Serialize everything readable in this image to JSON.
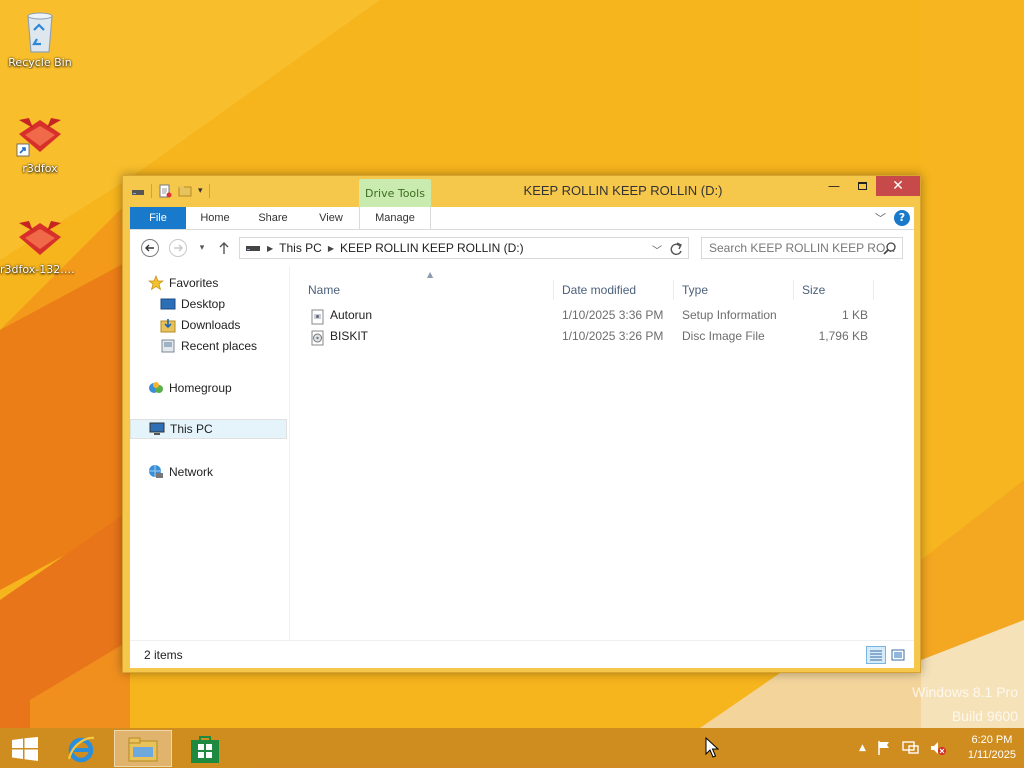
{
  "desktop": {
    "icons": [
      {
        "label": "Recycle Bin",
        "icon": "recycle-bin-icon"
      },
      {
        "label": "r3dfox",
        "icon": "r3dfox-icon"
      },
      {
        "label": "r3dfox-132.0...",
        "icon": "r3dfox-installer-icon"
      }
    ],
    "watermark": {
      "line1": "Windows 8.1 Pro",
      "line2": "Build 9600"
    }
  },
  "window": {
    "title": "KEEP ROLLIN KEEP ROLLIN (D:)",
    "contextual_tab_group": "Drive Tools",
    "ribbon_tabs": [
      "File",
      "Home",
      "Share",
      "View",
      "Manage"
    ],
    "address": {
      "crumbs": [
        "This PC",
        "KEEP ROLLIN KEEP ROLLIN (D:)"
      ]
    },
    "search": {
      "placeholder": "Search KEEP ROLLIN KEEP RO..."
    },
    "nav_pane": {
      "favorites": "Favorites",
      "desktop": "Desktop",
      "downloads": "Downloads",
      "recent_places": "Recent places",
      "homegroup": "Homegroup",
      "this_pc": "This PC",
      "network": "Network"
    },
    "columns": [
      "Name",
      "Date modified",
      "Type",
      "Size"
    ],
    "files": [
      {
        "name": "Autorun",
        "date": "1/10/2025 3:36 PM",
        "type": "Setup Information",
        "size": "1 KB",
        "icon": "setup-info-file-icon"
      },
      {
        "name": "BISKIT",
        "date": "1/10/2025 3:26 PM",
        "type": "Disc Image File",
        "size": "1,796 KB",
        "icon": "disc-image-file-icon"
      }
    ],
    "status": "2 items",
    "colors": {
      "file_tab": "#1979ca",
      "drive_tools": "#c9ebb0",
      "close": "#c7494a",
      "frame": "#f5c74b"
    }
  },
  "taskbar": {
    "apps": [
      "internet-explorer-icon",
      "file-explorer-icon",
      "store-icon"
    ],
    "clock": {
      "time": "6:20 PM",
      "date": "1/11/2025"
    }
  }
}
